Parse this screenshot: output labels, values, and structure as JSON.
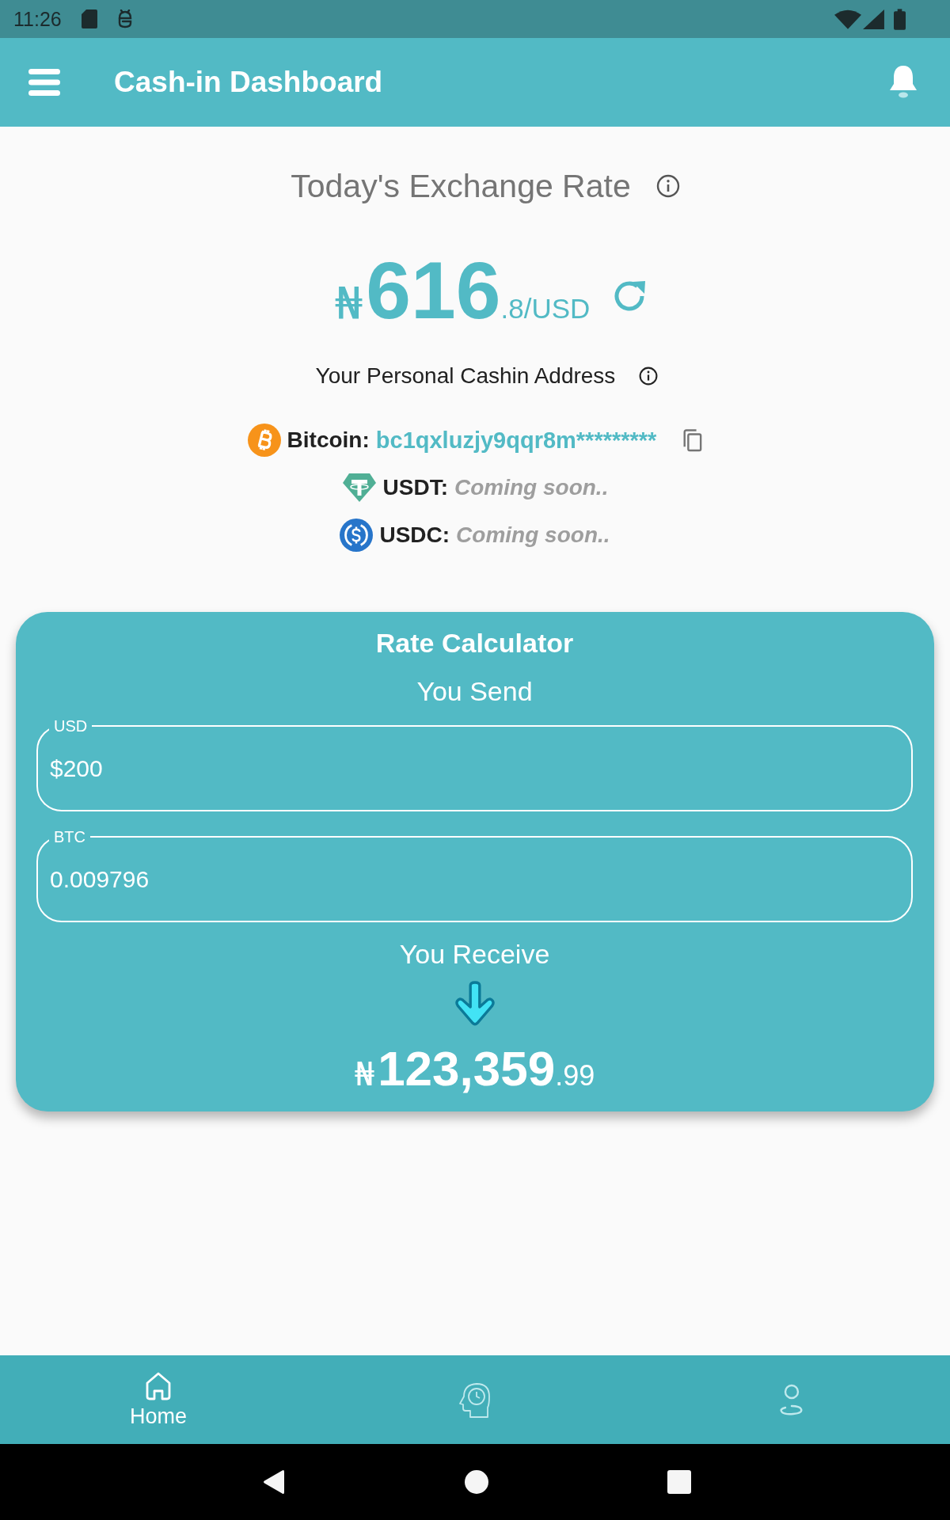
{
  "status_bar": {
    "time": "11:26"
  },
  "app_bar": {
    "title": "Cash-in Dashboard"
  },
  "exchange_rate": {
    "title": "Today's Exchange Rate",
    "symbol": "₦",
    "whole": "616",
    "fraction": ".8/USD"
  },
  "cashin_address": {
    "title": "Your Personal Cashin Address",
    "assets": [
      {
        "kind": "bitcoin",
        "label": "Bitcoin:",
        "value": "bc1qxluzjy9qqr8m*********",
        "available": true
      },
      {
        "kind": "usdt",
        "label": "USDT:",
        "value": "Coming soon..",
        "available": false
      },
      {
        "kind": "usdc",
        "label": "USDC:",
        "value": "Coming soon..",
        "available": false
      }
    ]
  },
  "rate_calculator": {
    "title": "Rate Calculator",
    "send_label": "You Send",
    "fields": [
      {
        "label": "USD",
        "value": "$200"
      },
      {
        "label": "BTC",
        "value": "0.009796"
      }
    ],
    "receive_label": "You Receive",
    "result": {
      "symbol": "₦",
      "whole": "123,359",
      "fraction": ".99"
    }
  },
  "bottom_nav": [
    {
      "kind": "home",
      "label": "Home",
      "selected": true
    },
    {
      "kind": "history",
      "selected": false
    },
    {
      "kind": "profile",
      "selected": false
    }
  ]
}
